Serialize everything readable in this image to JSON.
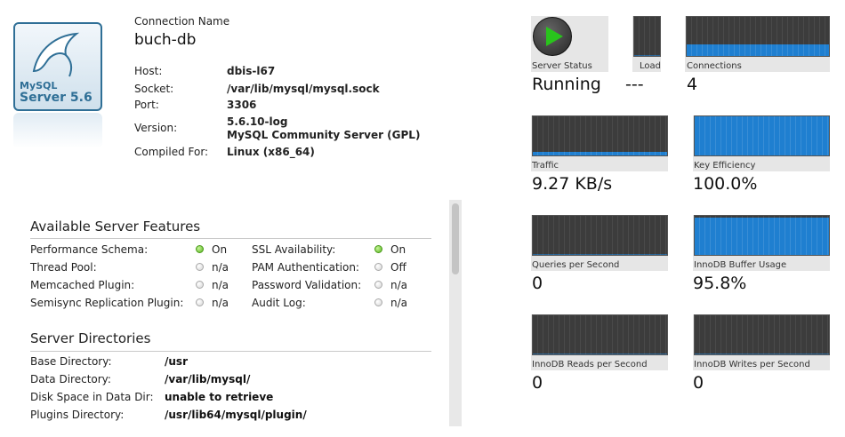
{
  "logo": {
    "line1": "MySQL",
    "line2": "Server 5.6"
  },
  "connection": {
    "name_label": "Connection Name",
    "name": "buch-db",
    "fields": [
      {
        "label": "Host:",
        "value": "dbis-l67"
      },
      {
        "label": "Socket:",
        "value": "/var/lib/mysql/mysql.sock"
      },
      {
        "label": "Port:",
        "value": "3306"
      },
      {
        "label": "Version:",
        "value": "5.6.10-log",
        "value2": "MySQL Community Server (GPL)"
      },
      {
        "label": "Compiled For:",
        "value": "Linux (x86_64)"
      }
    ]
  },
  "features": {
    "title": "Available Server Features",
    "left": [
      {
        "label": "Performance Schema:",
        "state": "On",
        "on": true
      },
      {
        "label": "Thread Pool:",
        "state": "n/a",
        "on": false
      },
      {
        "label": "Memcached Plugin:",
        "state": "n/a",
        "on": false
      },
      {
        "label": "Semisync Replication Plugin:",
        "state": "n/a",
        "on": false
      }
    ],
    "right": [
      {
        "label": "SSL Availability:",
        "state": "On",
        "on": true
      },
      {
        "label": "PAM Authentication:",
        "state": "Off",
        "on": false
      },
      {
        "label": "Password Validation:",
        "state": "n/a",
        "on": false
      },
      {
        "label": "Audit Log:",
        "state": "n/a",
        "on": false
      }
    ]
  },
  "directories": {
    "title": "Server Directories",
    "rows": [
      {
        "label": "Base Directory:",
        "value": "/usr"
      },
      {
        "label": "Data Directory:",
        "value": "/var/lib/mysql/"
      },
      {
        "label": "Disk Space in Data Dir:",
        "value": "unable to retrieve"
      },
      {
        "label": "Plugins Directory:",
        "value": "/usr/lib64/mysql/plugin/"
      }
    ]
  },
  "status": {
    "server_status": {
      "caption": "Server Status",
      "value": "Running"
    },
    "load": {
      "caption": "Load",
      "value": "---",
      "level": 0
    },
    "connections": {
      "caption": "Connections",
      "value": "4",
      "level": 0.3
    },
    "traffic": {
      "caption": "Traffic",
      "value": "9.27 KB/s",
      "level": 0.08
    },
    "key_efficiency": {
      "caption": "Key Efficiency",
      "value": "100.0%",
      "level": 1.0
    },
    "queries": {
      "caption": "Queries per Second",
      "value": "0",
      "level": 0
    },
    "innodb_buffer": {
      "caption": "InnoDB Buffer Usage",
      "value": "95.8%",
      "level": 0.958
    },
    "innodb_reads": {
      "caption": "InnoDB Reads per Second",
      "value": "0",
      "level": 0
    },
    "innodb_writes": {
      "caption": "InnoDB Writes per Second",
      "value": "0",
      "level": 0
    }
  },
  "colors": {
    "graph_fill": "#1f7fd0",
    "graph_bg": "#3c3c3c",
    "on_dot": "#58b51f",
    "play": "#29c41c"
  }
}
